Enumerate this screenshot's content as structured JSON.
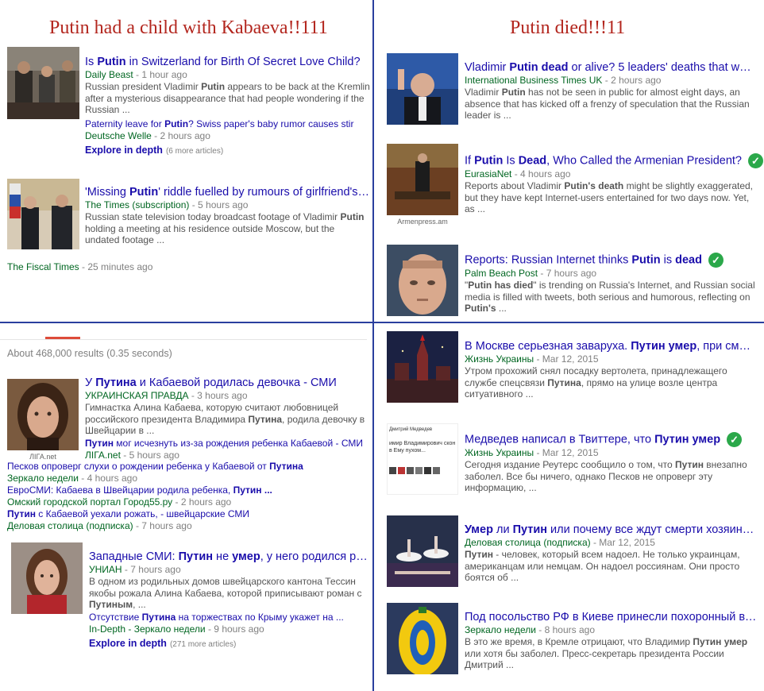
{
  "titles": {
    "left": "Putin had a child with Kabaeva!!111",
    "right": "Putin died!!!11"
  },
  "q1": {
    "items": [
      {
        "headline_parts": [
          "Is ",
          "Putin",
          " in Switzerland for Birth Of Secret Love Child?"
        ],
        "source": "Daily Beast",
        "time": " - 1 hour ago",
        "snippet_parts": [
          "Russian president Vladimir ",
          "Putin",
          " appears to be back at the Kremlin after a mysterious disappearance that had people wondering if the Russian ..."
        ],
        "sub_link_parts": [
          "Paternity leave for ",
          "Putin",
          "? Swiss paper's baby rumor causes stir"
        ],
        "sub_source": "Deutsche Welle",
        "sub_time": " - 2 hours ago",
        "explore": "Explore in depth",
        "explore_more": "(6 more articles)"
      },
      {
        "headline_parts": [
          "'Missing ",
          "Putin",
          "' riddle fuelled by rumours of girlfriend's b..."
        ],
        "source": "The Times (subscription)",
        "time": " - 5 hours ago",
        "snippet_parts": [
          "Russian state television today broadcast footage of Vladimir ",
          "Putin",
          " holding a meeting at his residence outside Moscow, but the undated footage ..."
        ],
        "extra_source": "The Fiscal Times",
        "extra_time": " - 25 minutes ago"
      }
    ]
  },
  "q2": {
    "items": [
      {
        "headline_parts": [
          "Vladimir ",
          "Putin dead",
          " or alive? 5 leaders' deaths that wer..."
        ],
        "source": "International Business Times UK",
        "time": " - 2 hours ago",
        "snippet_parts": [
          "Vladimir ",
          "Putin",
          " has not be seen in public for almost eight days, an absence that has kicked off a frenzy of speculation that the Russian leader is ..."
        ],
        "verified": false
      },
      {
        "headline_parts": [
          "If ",
          "Putin",
          " Is ",
          "Dead",
          ", Who Called the Armenian President?"
        ],
        "source": "EurasiaNet",
        "time": " - 4 hours ago",
        "snippet_parts": [
          "Reports about Vladimir ",
          "Putin's death",
          " might be slightly exaggerated, but they have kept Internet-users entertained for two days now. Yet, as ..."
        ],
        "caption": "Armenpress.am",
        "verified": true
      },
      {
        "headline_parts": [
          "Reports: Russian Internet thinks ",
          "Putin",
          " is ",
          "dead"
        ],
        "source": "Palm Beach Post",
        "time": " - 7 hours ago",
        "snippet_parts": [
          "\"",
          "Putin has died",
          "\" is trending on Russia's Internet, and Russian social media is filled with tweets, both serious and humorous, reflecting on ",
          "Putin's",
          " ..."
        ],
        "verified": true
      }
    ]
  },
  "q3": {
    "results_count": "About 468,000 results (0.35 seconds)",
    "items": [
      {
        "headline_parts": [
          "У ",
          "Путина",
          " и Кабаевой родилась девочка - СМИ"
        ],
        "source": "УКРАИНСКАЯ ПРАВДА",
        "time": " - 3 hours ago",
        "snippet_parts": [
          "Гимнастка Алина Кабаева, которую считают любовницей российского президента Владимира ",
          "Путина",
          ", родила девочку в Швейцарии в ..."
        ],
        "caption": "ЛІГА.net",
        "sub_link_parts": [
          "Путин",
          " мог исчезнуть из-за рождения ребенка Кабаевой - СМИ"
        ],
        "sub_source": "ЛІГА.net",
        "sub_time": " - 5 hours ago",
        "more_links": [
          {
            "text_parts": [
              "Песков опроверг слухи о рождении ребенка у Кабаевой от ",
              "Путина"
            ],
            "source": "Зеркало недели",
            "time": " - 4 hours ago"
          },
          {
            "text_parts": [
              "ЕвроСМИ: Кабаева в Швейцарии родила ребенка, ",
              "Путин ..."
            ],
            "source": "Омский городской портал Город55.ру",
            "time": " - 2 hours ago"
          },
          {
            "text_parts": [
              "Путин",
              " с Кабаевой уехали рожать, - швейцарские СМИ"
            ],
            "source": "Деловая столица (подписка)",
            "time": " - 7 hours ago"
          }
        ]
      },
      {
        "headline_parts": [
          "Западные СМИ: ",
          "Путин",
          " не ",
          "умер",
          ", у него родился ребе..."
        ],
        "source": "УНИАН",
        "time": " - 7 hours ago",
        "snippet_parts": [
          "В одном из родильных домов швейцарского кантона Тессин якобы рожала Алина Кабаева, которой приписывают роман с ",
          "Путиным",
          ", ..."
        ],
        "sub_link_parts": [
          "Отсутствие ",
          "Путина",
          " на торжествах по Крыму укажет на ..."
        ],
        "sub_source": "In-Depth - Зеркало недели",
        "sub_time": " - 9 hours ago",
        "explore": "Explore in depth",
        "explore_more": "(271 more articles)"
      }
    ]
  },
  "q4": {
    "items": [
      {
        "headline_parts": [
          "В Москве серьезная заваруха. ",
          "Путин умер",
          ", при смер..."
        ],
        "source": "Жизнь Украины",
        "time": " - Mar 12, 2015",
        "snippet_parts": [
          "Утром прохожий снял посадку вертолета, принадлежащего службе спецсвязи ",
          "Путина",
          ", прямо на улице возле центра ситуативного ..."
        ],
        "verified": false
      },
      {
        "headline_parts": [
          "Медведев написал в Твиттере, что ",
          "Путин умер"
        ],
        "source": "Жизнь Украины",
        "time": " - Mar 12, 2015",
        "snippet_parts": [
          "Сегодня издание Реутерс сообщило о том, что ",
          "Путин",
          " внезапно заболел. Все бы ничего, однако Песков не опроверг эту информацию, ..."
        ],
        "verified": true,
        "tweet_name": "Дмитрий Медведев",
        "tweet_text": "имир Владимирович скон\nв Ему пухом..."
      },
      {
        "headline_parts": [
          "Умер",
          " ли ",
          "Путин",
          " или почему все ждут смерти хозяина ..."
        ],
        "source": "Деловая столица (подписка)",
        "time": " - Mar 12, 2015",
        "snippet_parts": [
          "Путин",
          " - человек, который всем надоел. Не только украинцам, американцам или немцам. Он надоел россиянам. Они просто боятся об ..."
        ],
        "verified": false
      },
      {
        "headline_parts": [
          "Под посольство РФ в Киеве принесли похоронный ве..."
        ],
        "source": "Зеркало недели",
        "time": " - 8 hours ago",
        "snippet_parts": [
          "В это же время, в Кремле отрицают, что Владимир ",
          "Путин умер",
          " или хотя бы заболел. Пресс-секретарь президента России Дмитрий ..."
        ],
        "verified": false
      }
    ]
  },
  "colors": {
    "link": "#1a0dab",
    "source": "#006621",
    "title_red": "#b3261e",
    "divider": "#2a3f9e",
    "check": "#2ba84a"
  }
}
